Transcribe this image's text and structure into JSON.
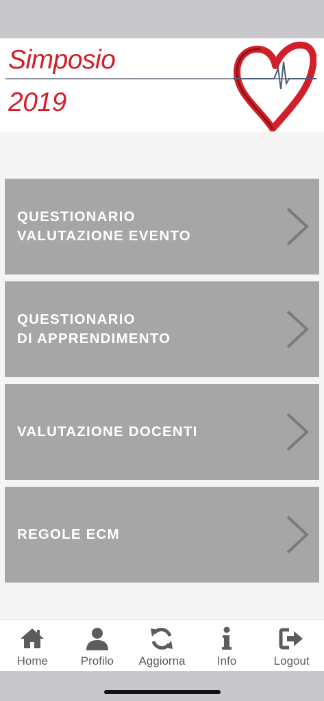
{
  "header": {
    "brand_line1": "Simposio",
    "brand_line2": "2019",
    "brand_color": "#d1202a",
    "logo_icon": "heart-ecg-icon"
  },
  "menu": {
    "items": [
      {
        "label": "QUESTIONARIO\nVALUTAZIONE EVENTO",
        "icon": "chevron-right-icon"
      },
      {
        "label": "QUESTIONARIO\nDI APPRENDIMENTO",
        "icon": "chevron-right-icon"
      },
      {
        "label": "VALUTAZIONE DOCENTI",
        "icon": "chevron-right-icon"
      },
      {
        "label": "REGOLE ECM",
        "icon": "chevron-right-icon"
      }
    ],
    "item_bg": "#a6a6a6"
  },
  "tabbar": {
    "tabs": [
      {
        "label": "Home",
        "icon": "home-icon"
      },
      {
        "label": "Profilo",
        "icon": "user-icon"
      },
      {
        "label": "Aggiorna",
        "icon": "refresh-icon"
      },
      {
        "label": "Info",
        "icon": "info-icon"
      },
      {
        "label": "Logout",
        "icon": "logout-icon"
      }
    ],
    "icon_color": "#5c5c5c"
  }
}
